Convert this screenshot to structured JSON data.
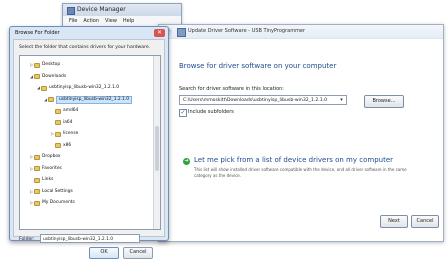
{
  "device_manager": {
    "title": "Device Manager",
    "menu": [
      "File",
      "Action",
      "View",
      "Help"
    ]
  },
  "wizard": {
    "title": "Update Driver Software - USB TinyProgrammer",
    "heading": "Browse for driver software on your computer",
    "search_label": "Search for driver software in this location:",
    "path_value": "C:\\Users\\mmoskitt\\Downloads\\usbtinyisp_libusb-win32_1.2.1.0",
    "browse_label": "Browse...",
    "include_subfolders_label": "Include subfolders",
    "include_subfolders_checked": true,
    "pick_title": "Let me pick from a list of device drivers on my computer",
    "pick_desc": "This list will show installed driver software compatible with the device, and all driver software in the same category as the device.",
    "next_label": "Next",
    "cancel_label": "Cancel"
  },
  "browse_dialog": {
    "title": "Browse For Folder",
    "instruction": "Select the folder that contains drivers for your hardware.",
    "tree": [
      {
        "label": "Desktop",
        "toggle": "▷",
        "depth": 1
      },
      {
        "label": "Downloads",
        "toggle": "◢",
        "depth": 1
      },
      {
        "label": "usbtinyisp_libusb-win32_1.2.1.0",
        "toggle": "◢",
        "depth": 2
      },
      {
        "label": "usbtinyisp_libusb-win32_1.2.1.0",
        "toggle": "◢",
        "depth": 3,
        "selected": true
      },
      {
        "label": "amd64",
        "toggle": "",
        "depth": 4
      },
      {
        "label": "ia64",
        "toggle": "",
        "depth": 4
      },
      {
        "label": "license",
        "toggle": "▷",
        "depth": 4
      },
      {
        "label": "x86",
        "toggle": "",
        "depth": 4
      },
      {
        "label": "Dropbox",
        "toggle": "▷",
        "depth": 1
      },
      {
        "label": "Favorites",
        "toggle": "▷",
        "depth": 1
      },
      {
        "label": "Links",
        "toggle": "",
        "depth": 1
      },
      {
        "label": "Local Settings",
        "toggle": "▷",
        "depth": 1
      },
      {
        "label": "My Documents",
        "toggle": "▷",
        "depth": 1
      }
    ],
    "folder_label": "Folder:",
    "folder_value": "usbtinyisp_libusb-win32_1.2.1.0",
    "ok_label": "OK",
    "cancel_label": "Cancel"
  }
}
